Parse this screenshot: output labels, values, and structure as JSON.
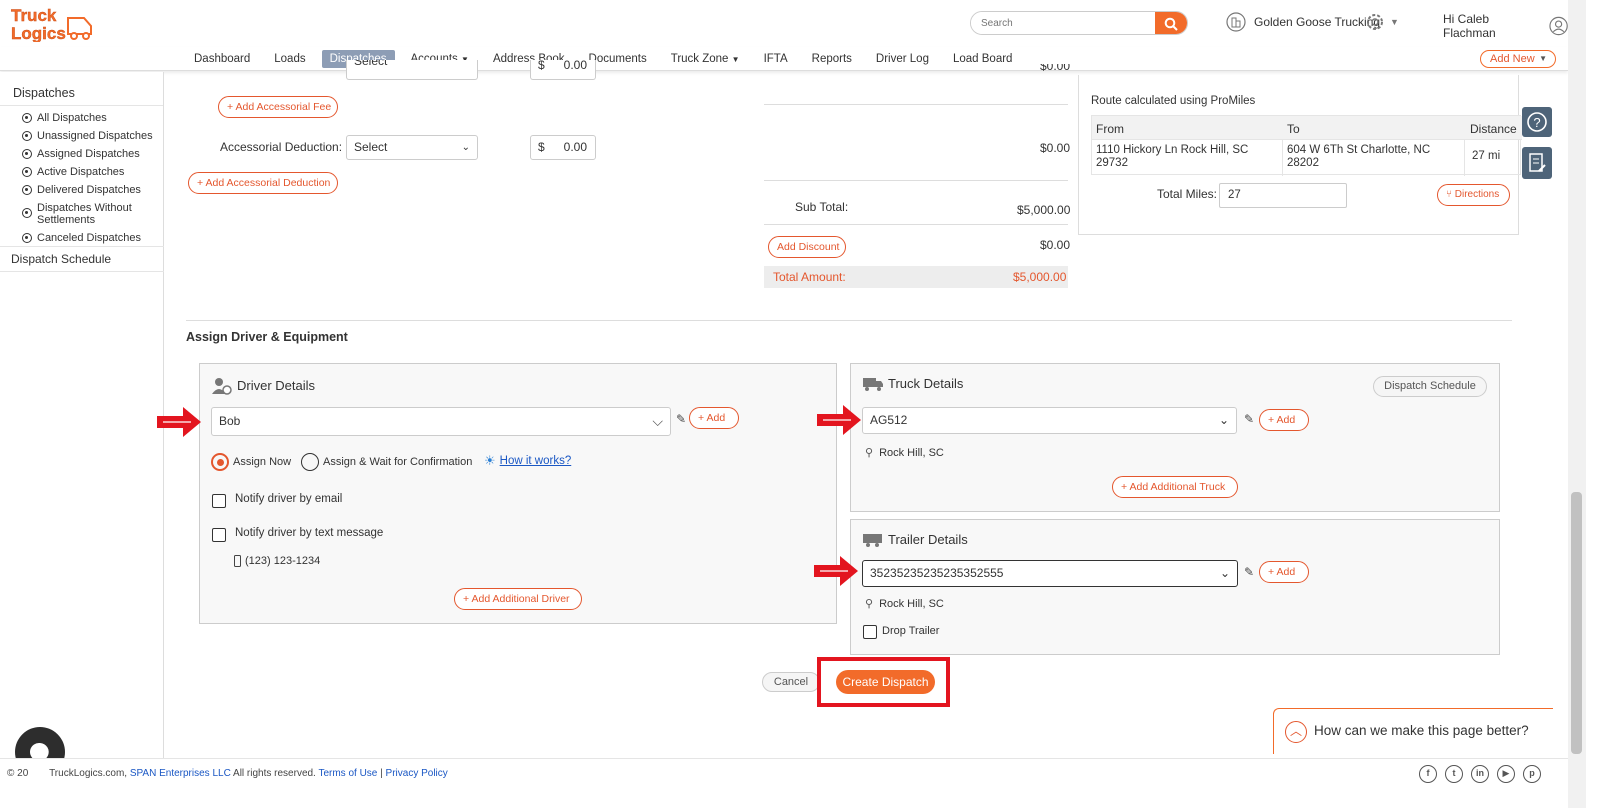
{
  "header": {
    "logo_text_1": "Truck",
    "logo_text_2": "Logics",
    "search_placeholder": "Search",
    "company": "Golden Goose Trucking",
    "greeting": "Hi Caleb Flachman"
  },
  "nav": {
    "items": [
      "Dashboard",
      "Loads",
      "Dispatches",
      "Accounts",
      "Address Book",
      "Documents",
      "Truck Zone",
      "IFTA",
      "Reports",
      "Driver Log",
      "Load Board"
    ],
    "active": "Dispatches",
    "add_new": "Add New"
  },
  "sidebar": {
    "title": "Dispatches",
    "items": [
      "All Dispatches",
      "Unassigned Dispatches",
      "Assigned Dispatches",
      "Active Dispatches",
      "Delivered Dispatches",
      "Dispatches Without Settlements",
      "Canceled Dispatches"
    ],
    "schedule": "Dispatch Schedule"
  },
  "fees": {
    "add_accessorial_fee": "Add Accessorial Fee",
    "accessorial_deduction_label": "Accessorial Deduction:",
    "deduction_select": "Select",
    "top_select": "Select",
    "currency": "$",
    "deduction_amount": "0.00",
    "deduction_total": "$0.00",
    "add_accessorial_deduction": "Add Accessorial Deduction",
    "top_amount": "0.00",
    "top_total": "$0.00"
  },
  "totals": {
    "subtotal_label": "Sub Total:",
    "subtotal_value": "$5,000.00",
    "add_discount": "Add Discount",
    "discount_value": "$0.00",
    "total_label": "Total Amount:",
    "total_value": "$5,000.00"
  },
  "route": {
    "caption": "Route calculated using ProMiles",
    "col_from": "From",
    "col_to": "To",
    "col_distance": "Distance",
    "from": "1110 Hickory Ln Rock Hill, SC 29732",
    "to": "604 W 6Th St Charlotte, NC 28202",
    "distance": "27 mi",
    "total_miles_label": "Total Miles:",
    "total_miles": "27",
    "directions": "Directions"
  },
  "assign": {
    "heading": "Assign Driver & Equipment",
    "driver": {
      "title": "Driver Details",
      "selected": "Bob",
      "add": "Add",
      "assign_now": "Assign Now",
      "assign_wait": "Assign & Wait for Confirmation",
      "how_it_works": "How it works?",
      "notify_email": "Notify driver by email",
      "notify_text": "Notify driver by text message",
      "phone": "(123) 123-1234",
      "add_additional": "Add Additional Driver"
    },
    "truck": {
      "title": "Truck Details",
      "dispatch_schedule": "Dispatch Schedule",
      "selected": "AG512",
      "add": "Add",
      "location": "Rock Hill, SC",
      "add_additional": "Add Additional Truck"
    },
    "trailer": {
      "title": "Trailer Details",
      "selected": "35235235235235352555",
      "add": "Add",
      "location": "Rock Hill, SC",
      "drop_trailer": "Drop Trailer"
    }
  },
  "actions": {
    "cancel": "Cancel",
    "create": "Create Dispatch"
  },
  "feedback": {
    "text": "How can we make this page better?"
  },
  "footer": {
    "copyright_prefix": "© 20",
    "copyright_site": "TruckLogics.com,",
    "company_link": "SPAN Enterprises LLC",
    "rights": "All rights reserved.",
    "terms": "Terms of Use",
    "sep": "|",
    "privacy": "Privacy Policy"
  },
  "social_icons": [
    "facebook-icon",
    "twitter-icon",
    "linkedin-icon",
    "youtube-icon",
    "pinterest-icon"
  ],
  "colors": {
    "accent": "#f26b2a",
    "accent_text": "#e4572e",
    "nav_active": "#8d9db5",
    "annotation_red": "#e3151f",
    "link_blue": "#1a57c4",
    "side_icon": "#4e6479"
  }
}
